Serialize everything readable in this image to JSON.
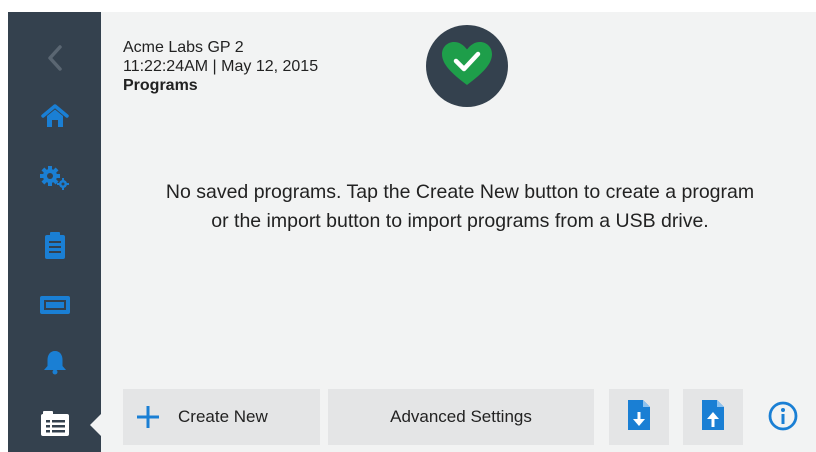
{
  "header": {
    "device_name": "Acme Labs GP 2",
    "datetime": "11:22:24AM | May 12, 2015",
    "section": "Programs"
  },
  "status": {
    "icon": "heart-check-icon",
    "color": "#1e9e4a"
  },
  "sidebar": {
    "items": [
      {
        "icon": "back-chevron-icon",
        "active": false
      },
      {
        "icon": "home-icon",
        "active": false
      },
      {
        "icon": "settings-gears-icon",
        "active": false
      },
      {
        "icon": "clipboard-icon",
        "active": false
      },
      {
        "icon": "display-icon",
        "active": false
      },
      {
        "icon": "bell-icon",
        "active": false
      },
      {
        "icon": "programs-list-icon",
        "active": true
      }
    ]
  },
  "main": {
    "empty_message": "No saved programs. Tap the Create New button to create a program or the import button to import programs from a USB drive."
  },
  "toolbar": {
    "create_label": "Create New",
    "advanced_label": "Advanced Settings",
    "import_icon": "file-import-icon",
    "export_icon": "file-export-icon",
    "info_icon": "info-icon"
  },
  "colors": {
    "accent": "#1a7fd4",
    "sidebar_bg": "#34414e",
    "background": "#f2f3f3",
    "button_bg": "#e4e5e6"
  }
}
